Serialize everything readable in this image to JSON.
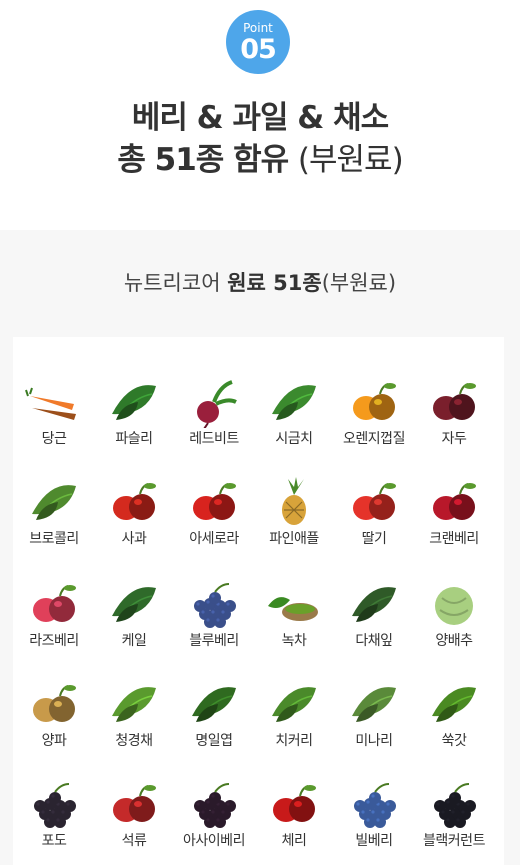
{
  "badge": {
    "top_text": "Point",
    "number": "05"
  },
  "headline": {
    "line1": "베리 & 과일 & 채소",
    "line2_main": "총 51종 함유",
    "line2_sub": "(부원료)"
  },
  "subheading": {
    "prefix": "뉴트리코어 ",
    "bold": "원료 51종",
    "suffix": "(부원료)"
  },
  "items": [
    {
      "label": "당근",
      "icon": "carrot-icon",
      "color": "#f07a2a"
    },
    {
      "label": "파슬리",
      "icon": "parsley-icon",
      "color": "#2f7a2a"
    },
    {
      "label": "레드비트",
      "icon": "red-beet-icon",
      "color": "#9a1f3c"
    },
    {
      "label": "시금치",
      "icon": "spinach-icon",
      "color": "#3b8a2e"
    },
    {
      "label": "오렌지껍질",
      "icon": "orange-icon",
      "color": "#f59a1c"
    },
    {
      "label": "자두",
      "icon": "plum-icon",
      "color": "#7a1f2c"
    },
    {
      "label": "브로콜리",
      "icon": "broccoli-icon",
      "color": "#4f8a2e"
    },
    {
      "label": "사과",
      "icon": "apple-icon",
      "color": "#d42a1e"
    },
    {
      "label": "아세로라",
      "icon": "acerola-icon",
      "color": "#d8231e"
    },
    {
      "label": "파인애플",
      "icon": "pineapple-icon",
      "color": "#d8a33a"
    },
    {
      "label": "딸기",
      "icon": "strawberry-icon",
      "color": "#e5332a"
    },
    {
      "label": "크랜베리",
      "icon": "cranberry-icon",
      "color": "#b8182a"
    },
    {
      "label": "라즈베리",
      "icon": "raspberry-icon",
      "color": "#e0405a"
    },
    {
      "label": "케일",
      "icon": "kale-icon",
      "color": "#2f6a2a"
    },
    {
      "label": "블루베리",
      "icon": "blueberry-icon",
      "color": "#3a4f8a"
    },
    {
      "label": "녹차",
      "icon": "green-tea-icon",
      "color": "#6aa02a"
    },
    {
      "label": "다채잎",
      "icon": "tatsoi-icon",
      "color": "#2f5a28"
    },
    {
      "label": "양배추",
      "icon": "cabbage-icon",
      "color": "#a8cf80"
    },
    {
      "label": "양파",
      "icon": "onion-icon",
      "color": "#c89a4a"
    },
    {
      "label": "청경채",
      "icon": "bok-choy-icon",
      "color": "#5a9a2e"
    },
    {
      "label": "명일엽",
      "icon": "ashitaba-icon",
      "color": "#2f6a20"
    },
    {
      "label": "치커리",
      "icon": "chicory-icon",
      "color": "#4a8a2a"
    },
    {
      "label": "미나리",
      "icon": "water-parsley-icon",
      "color": "#5a8a3a"
    },
    {
      "label": "쑥갓",
      "icon": "crown-daisy-icon",
      "color": "#4a8a22"
    },
    {
      "label": "포도",
      "icon": "grape-icon",
      "color": "#2a2430"
    },
    {
      "label": "석류",
      "icon": "pomegranate-icon",
      "color": "#c42a2a"
    },
    {
      "label": "아사이베리",
      "icon": "acai-berry-icon",
      "color": "#2a1a2a"
    },
    {
      "label": "체리",
      "icon": "cherry-icon",
      "color": "#c81a1a"
    },
    {
      "label": "빌베리",
      "icon": "bilberry-icon",
      "color": "#3a5a9a"
    },
    {
      "label": "블랙커런트",
      "icon": "blackcurrant-icon",
      "color": "#1a1a22"
    }
  ]
}
